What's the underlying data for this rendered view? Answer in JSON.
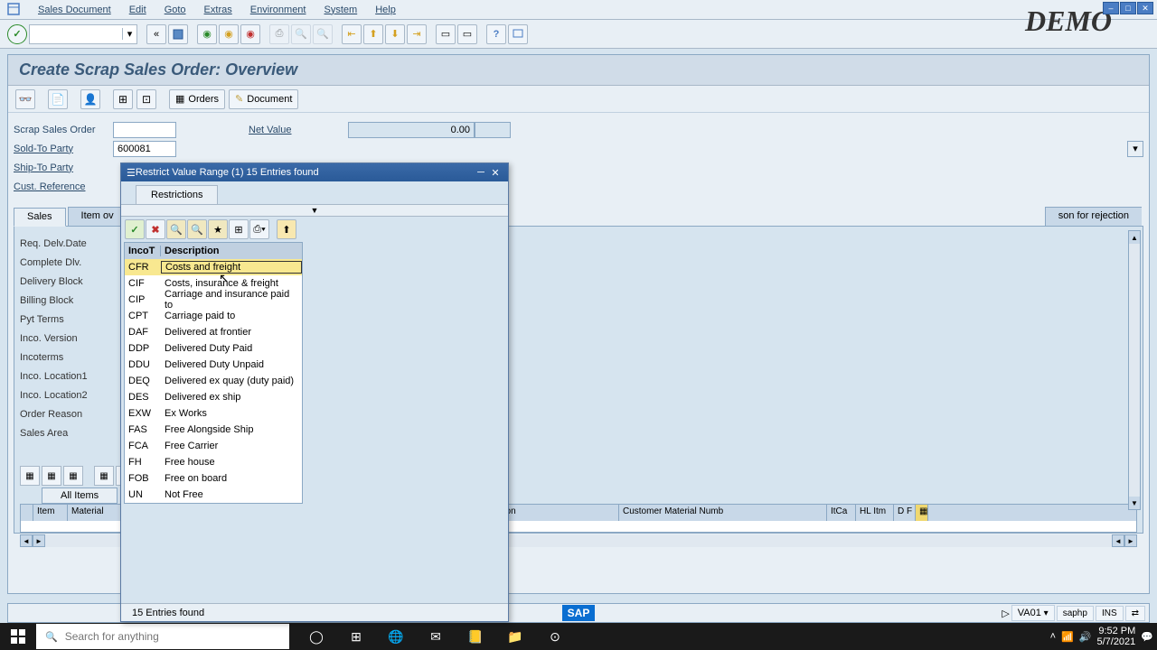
{
  "menu": {
    "items": [
      "Sales Document",
      "Edit",
      "Goto",
      "Extras",
      "Environment",
      "System",
      "Help"
    ]
  },
  "demo_watermark": "DEMO",
  "page_title": "Create Scrap Sales Order: Overview",
  "toolbar2": {
    "orders_label": "Orders",
    "document_label": "Document"
  },
  "form": {
    "scrap_order_label": "Scrap Sales Order",
    "scrap_order_value": "",
    "net_value_label": "Net Value",
    "net_value": "0.00",
    "sold_to_label": "Sold-To Party",
    "sold_to_value": "600081",
    "ship_to_label": "Ship-To Party",
    "cust_ref_label": "Cust. Reference"
  },
  "tabs": {
    "sales": "Sales",
    "item_ov": "Item ov",
    "reject": "son for rejection"
  },
  "sales_fields": {
    "req_delv": "Req. Delv.Date",
    "complete": "Complete Dlv.",
    "delv_block": "Delivery Block",
    "bill_block": "Billing Block",
    "pyt_terms": "Pyt Terms",
    "inco_ver": "Inco. Version",
    "incoterms": "Incoterms",
    "inco_loc1": "Inco. Location1",
    "inco_loc2": "Inco. Location2",
    "order_reason": "Order Reason",
    "sales_area": "Sales Area"
  },
  "all_items": "All Items",
  "grid_cols": {
    "item": "Item",
    "material": "Material",
    "ption": "ption",
    "cust_mat": "Customer Material Numb",
    "itca": "ItCa",
    "hlitm": "HL Itm",
    "df": "D F"
  },
  "popup": {
    "title": "Restrict Value Range (1)   15 Entries found",
    "tab": "Restrictions",
    "col1": "IncoT",
    "col2": "Description",
    "rows": [
      {
        "code": "CFR",
        "desc": "Costs and freight"
      },
      {
        "code": "CIF",
        "desc": "Costs, insurance & freight"
      },
      {
        "code": "CIP",
        "desc": "Carriage and insurance paid to"
      },
      {
        "code": "CPT",
        "desc": "Carriage paid to"
      },
      {
        "code": "DAF",
        "desc": "Delivered at frontier"
      },
      {
        "code": "DDP",
        "desc": "Delivered Duty Paid"
      },
      {
        "code": "DDU",
        "desc": "Delivered Duty Unpaid"
      },
      {
        "code": "DEQ",
        "desc": "Delivered ex quay (duty paid)"
      },
      {
        "code": "DES",
        "desc": "Delivered ex ship"
      },
      {
        "code": "EXW",
        "desc": "Ex Works"
      },
      {
        "code": "FAS",
        "desc": "Free Alongside Ship"
      },
      {
        "code": "FCA",
        "desc": "Free Carrier"
      },
      {
        "code": "FH",
        "desc": "Free house"
      },
      {
        "code": "FOB",
        "desc": "Free on board"
      },
      {
        "code": "UN",
        "desc": "Not Free"
      }
    ],
    "status": "15 Entries found"
  },
  "statusbar": {
    "sap": "SAP",
    "tcode": "VA01",
    "server": "saphp",
    "mode": "INS"
  },
  "taskbar": {
    "search_placeholder": "Search for anything",
    "time": "9:52 PM",
    "date": "5/7/2021"
  }
}
